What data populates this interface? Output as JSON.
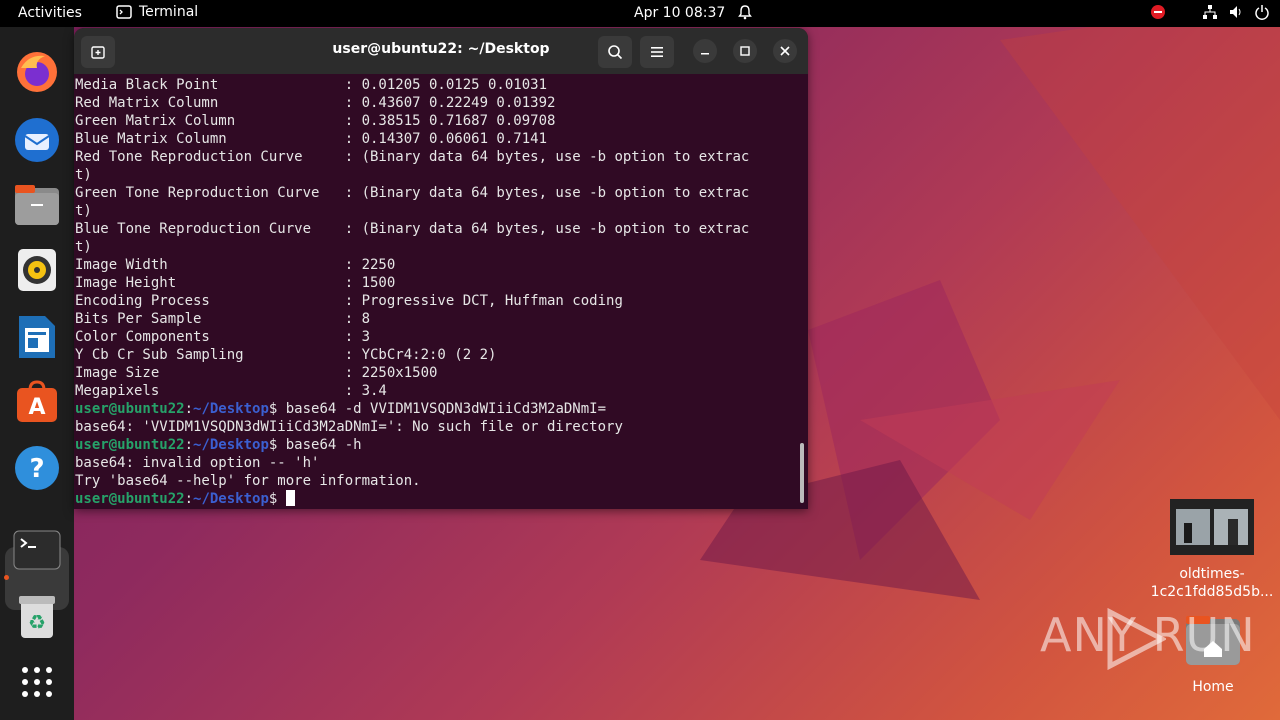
{
  "topbar": {
    "activities": "Activities",
    "app_name": "Terminal",
    "clock": "Apr 10  08:37"
  },
  "window": {
    "title": "user@ubuntu22: ~/Desktop"
  },
  "terminal": {
    "output_lines": [
      {
        "label": "Media Black Point",
        "value": ": 0.01205 0.0125 0.01031"
      },
      {
        "label": "Red Matrix Column",
        "value": ": 0.43607 0.22249 0.01392"
      },
      {
        "label": "Green Matrix Column",
        "value": ": 0.38515 0.71687 0.09708"
      },
      {
        "label": "Blue Matrix Column",
        "value": ": 0.14307 0.06061 0.7141"
      },
      {
        "label": "Red Tone Reproduction Curve",
        "value": ": (Binary data 64 bytes, use -b option to extrac"
      },
      {
        "label": "t)",
        "value": ""
      },
      {
        "label": "Green Tone Reproduction Curve",
        "value": ": (Binary data 64 bytes, use -b option to extrac"
      },
      {
        "label": "t)",
        "value": ""
      },
      {
        "label": "Blue Tone Reproduction Curve",
        "value": ": (Binary data 64 bytes, use -b option to extrac"
      },
      {
        "label": "t)",
        "value": ""
      },
      {
        "label": "Image Width",
        "value": ": 2250"
      },
      {
        "label": "Image Height",
        "value": ": 1500"
      },
      {
        "label": "Encoding Process",
        "value": ": Progressive DCT, Huffman coding"
      },
      {
        "label": "Bits Per Sample",
        "value": ": 8"
      },
      {
        "label": "Color Components",
        "value": ": 3"
      },
      {
        "label": "Y Cb Cr Sub Sampling",
        "value": ": YCbCr4:2:0 (2 2)"
      },
      {
        "label": "Image Size",
        "value": ": 2250x1500"
      },
      {
        "label": "Megapixels",
        "value": ": 3.4"
      }
    ],
    "prompt_user": "user@ubuntu22",
    "prompt_sep": ":",
    "prompt_path": "~/Desktop",
    "prompt_symbol": "$ ",
    "cmd1": "base64 -d VVIDM1VSQDN3dWIiiCd3M2aDNmI=",
    "out1": "base64: 'VVIDM1VSQDN3dWIiiCd3M2aDNmI=': No such file or directory",
    "cmd2": "base64 -h",
    "out2a": "base64: invalid option -- 'h'",
    "out2b": "Try 'base64 --help' for more information."
  },
  "desktop": {
    "file_label_1": "oldtimes-",
    "file_label_2": "1c2c1fdd85d5b...",
    "home_label": "Home",
    "watermark": "ANY  RUN"
  },
  "colors": {
    "terminal_bg": "#300a24",
    "prompt_user": "#26a269",
    "prompt_path": "#3b5fd0"
  }
}
